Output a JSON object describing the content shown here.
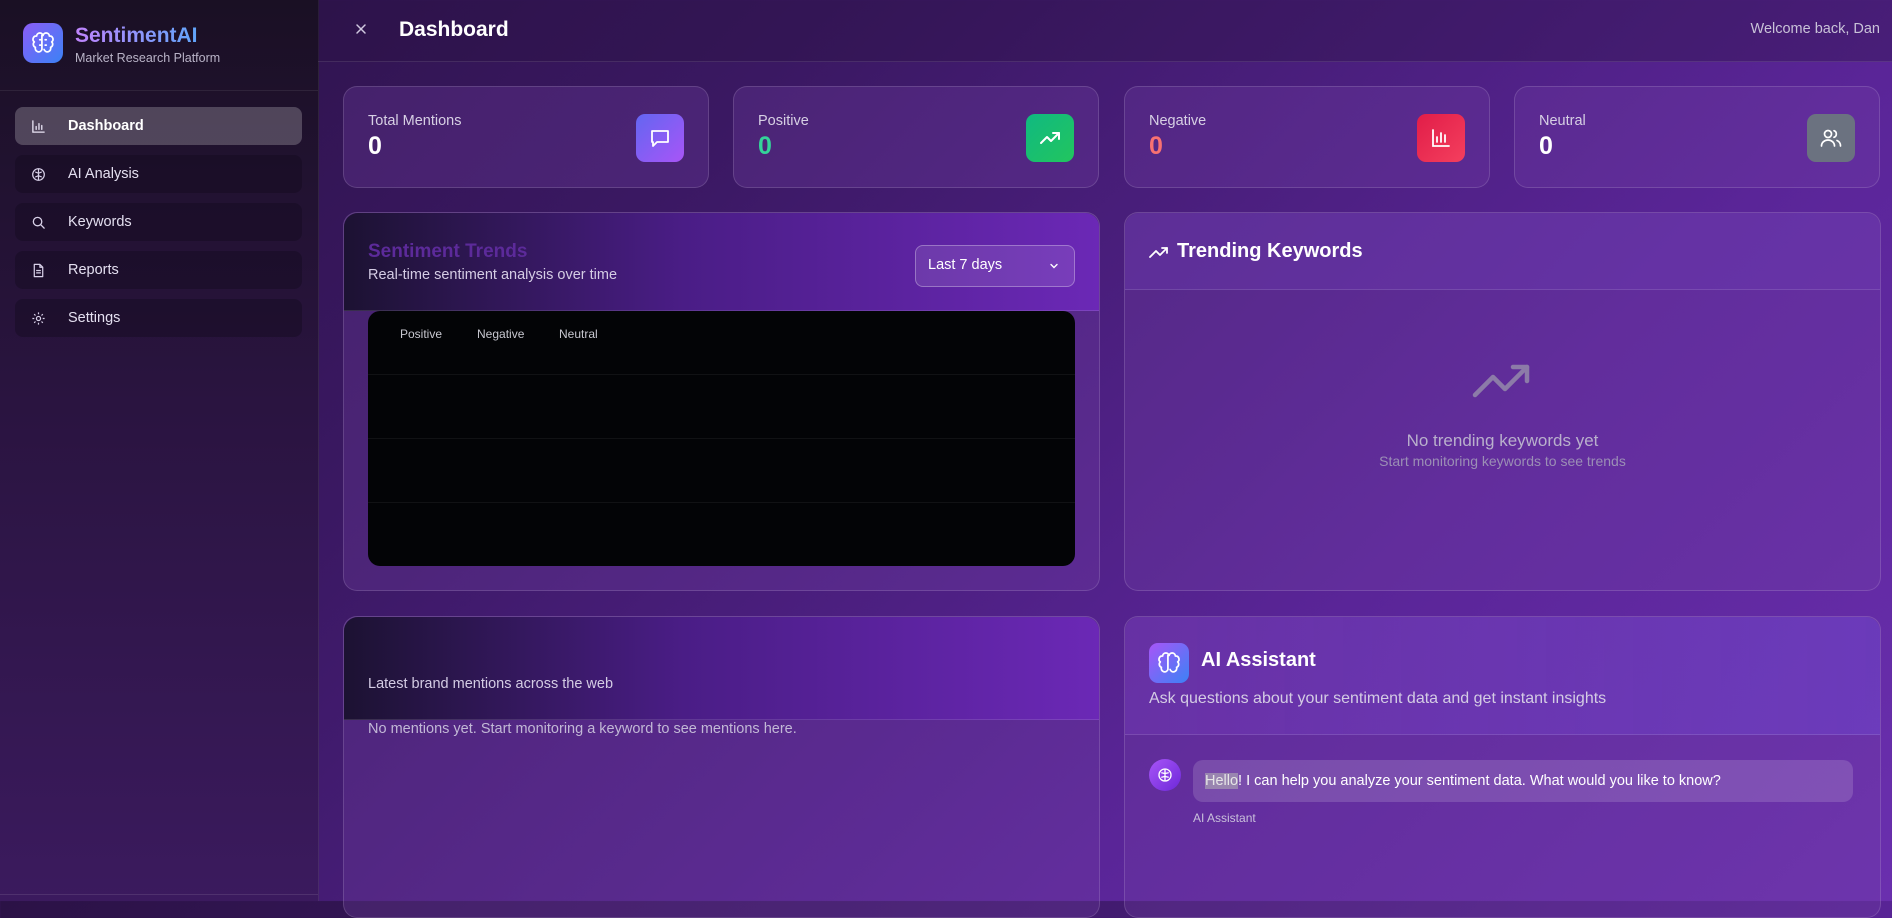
{
  "brand": {
    "name": "SentimentAI",
    "subtitle": "Market Research Platform",
    "logo_icon": "brain-icon"
  },
  "sidebar": {
    "items": [
      {
        "label": "Dashboard",
        "icon": "bar-chart-icon",
        "active": true
      },
      {
        "label": "AI Analysis",
        "icon": "brain-icon",
        "active": false
      },
      {
        "label": "Keywords",
        "icon": "search-icon",
        "active": false
      },
      {
        "label": "Reports",
        "icon": "document-icon",
        "active": false
      },
      {
        "label": "Settings",
        "icon": "gear-icon",
        "active": false
      }
    ]
  },
  "header": {
    "title": "Dashboard",
    "welcome": "Welcome back, Dan"
  },
  "stats": [
    {
      "label": "Total Mentions",
      "value": "0",
      "value_color": "#ffffff",
      "icon": "message-icon",
      "icon_bg": "linear-gradient(135deg,#6366f1,#a855f7)"
    },
    {
      "label": "Positive",
      "value": "0",
      "value_color": "#34d399",
      "icon": "trending-up-icon",
      "icon_bg": "linear-gradient(135deg,#10b981,#22c55e)"
    },
    {
      "label": "Negative",
      "value": "0",
      "value_color": "#f87171",
      "icon": "bar-chart-icon",
      "icon_bg": "linear-gradient(135deg,#e11d48,#f43f5e)"
    },
    {
      "label": "Neutral",
      "value": "0",
      "value_color": "#ffffff",
      "icon": "users-icon",
      "icon_bg": "#6b7280"
    }
  ],
  "trends": {
    "title": "Sentiment Trends",
    "subtitle": "Real-time sentiment analysis over time",
    "range_selected": "Last 7 days",
    "legend": [
      "Positive",
      "Negative",
      "Neutral"
    ]
  },
  "trending": {
    "title": "Trending Keywords",
    "empty_title": "No trending keywords yet",
    "empty_sub": "Start monitoring keywords to see trends"
  },
  "mentions": {
    "subtitle": "Latest brand mentions across the web",
    "empty": "No mentions yet. Start monitoring a keyword to see mentions here."
  },
  "assistant": {
    "title": "AI Assistant",
    "subtitle": "Ask questions about your sentiment data and get instant insights",
    "message_highlight": "Hello",
    "message_rest": "! I can help you analyze your sentiment data. What would you like to know?",
    "sender": "AI Assistant"
  }
}
